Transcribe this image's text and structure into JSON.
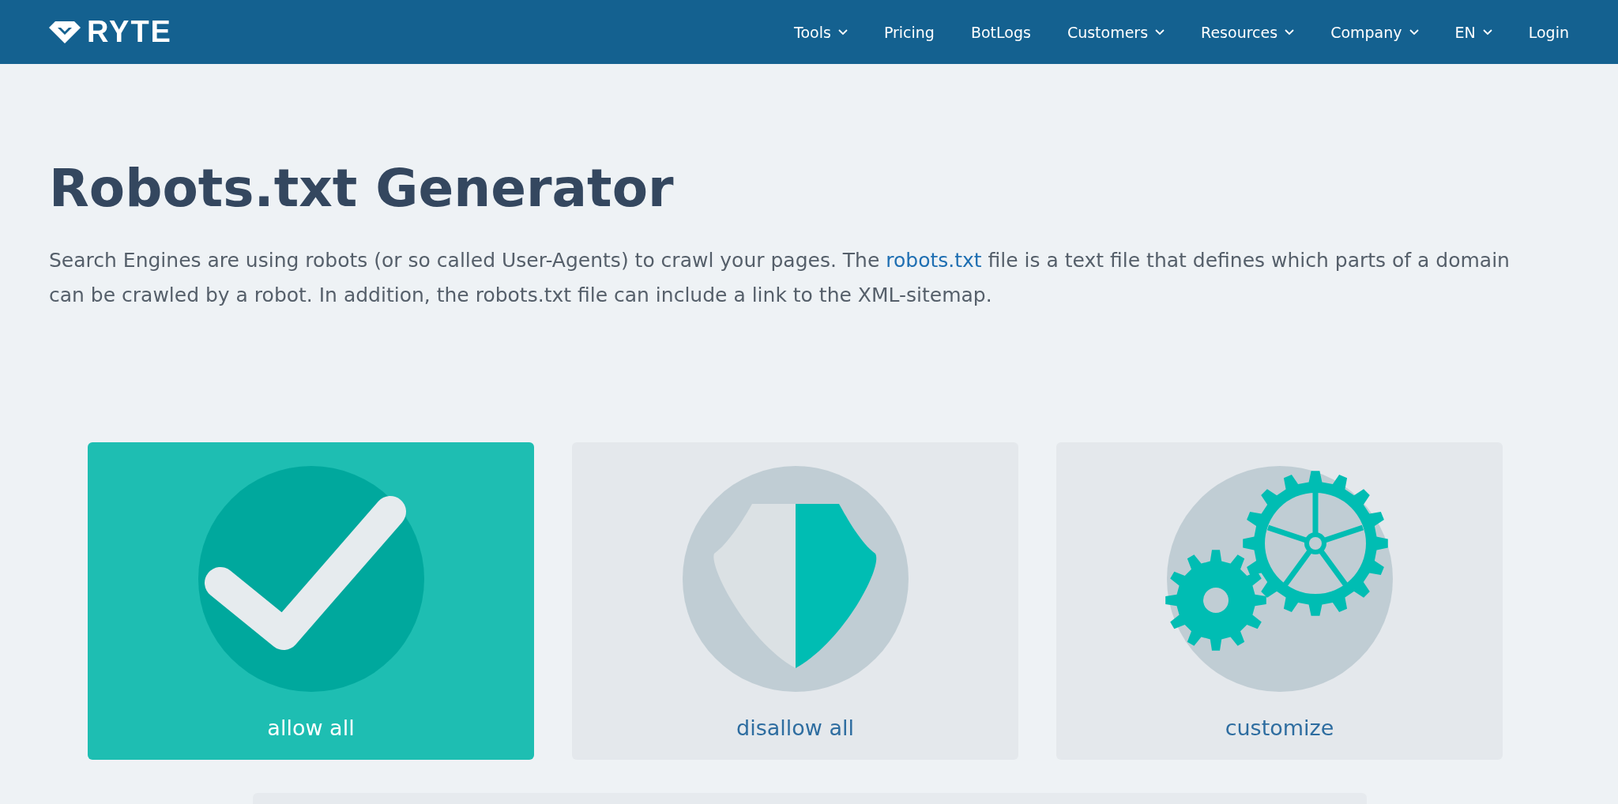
{
  "header": {
    "logo": "RYTE",
    "nav": [
      {
        "label": "Tools",
        "dropdown": true
      },
      {
        "label": "Pricing",
        "dropdown": false
      },
      {
        "label": "BotLogs",
        "dropdown": false
      },
      {
        "label": "Customers",
        "dropdown": true
      },
      {
        "label": "Resources",
        "dropdown": true
      },
      {
        "label": "Company",
        "dropdown": true
      },
      {
        "label": "EN",
        "dropdown": true
      },
      {
        "label": "Login",
        "dropdown": false
      }
    ]
  },
  "title": "Robots.txt Generator",
  "intro": {
    "before": "Search Engines are using robots (or so called User-Agents) to crawl your pages. The ",
    "link": "robots.txt",
    "after": " file is a text file that defines which parts of a domain can be crawled by a robot. In addition, the robots.txt file can include a link to the XML-sitemap."
  },
  "options": [
    {
      "kind": "allow",
      "label": "allow all",
      "selected": true
    },
    {
      "kind": "disallow",
      "label": "disallow all",
      "selected": false
    },
    {
      "kind": "customize",
      "label": "customize",
      "selected": false
    }
  ]
}
